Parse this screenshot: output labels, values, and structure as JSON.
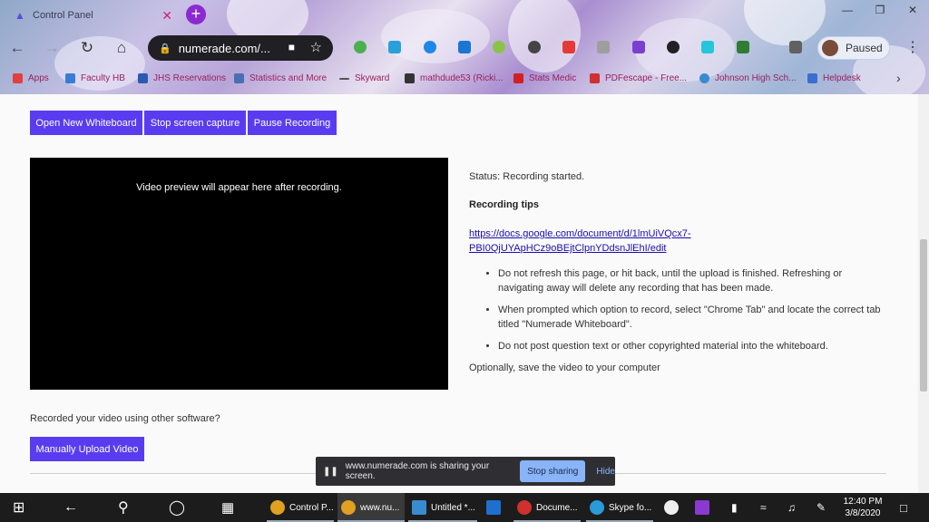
{
  "browser": {
    "tab_title": "Control Panel",
    "url": "numerade.com/...",
    "profile_status": "Paused"
  },
  "bookmarks": [
    {
      "label": "Apps",
      "color": "#e04040"
    },
    {
      "label": "Faculty HB",
      "color": "#3a7bd5"
    },
    {
      "label": "JHS Reservations",
      "color": "#2a5ab0"
    },
    {
      "label": "Statistics and More",
      "color": "#4a6fb0"
    },
    {
      "label": "Skyward",
      "color": "#555555"
    },
    {
      "label": "mathdude53 (Ricki...",
      "color": "#333333"
    },
    {
      "label": "Stats Medic",
      "color": "#d02020"
    },
    {
      "label": "PDFescape - Free...",
      "color": "#d03030"
    },
    {
      "label": "Johnson High Sch...",
      "color": "#3a8ad0"
    },
    {
      "label": "Helpdesk",
      "color": "#3a6fd0"
    }
  ],
  "toolbar": {
    "new_whiteboard": "Open New Whiteboard",
    "stop_capture": "Stop screen capture",
    "pause_recording": "Pause Recording"
  },
  "preview": {
    "message": "Video preview will appear here after recording."
  },
  "info": {
    "status": "Status: Recording started.",
    "tips_heading": "Recording tips",
    "tips_link": "https://docs.google.com/document/d/1lmUiVQcx7-PBI0QjUYApHCz9oBEjtClpnYDdsnJlEhI/edit",
    "tips": [
      "Do not refresh this page, or hit back, until the upload is finished. Refreshing or navigating away will delete any recording that has been made.",
      "When prompted which option to record, select \"Chrome Tab\" and locate the correct tab titled \"Numerade Whiteboard\".",
      "Do not post question text or other copyrighted material into the whiteboard."
    ],
    "optional": "Optionally, save the video to your computer"
  },
  "upload": {
    "prompt": "Recorded your video using other software?",
    "button": "Manually Upload Video"
  },
  "sharebar": {
    "message": "www.numerade.com is sharing your screen.",
    "stop": "Stop sharing",
    "hide": "Hide"
  },
  "taskbar": {
    "apps": [
      {
        "label": "Control P...",
        "color": "#e0a020"
      },
      {
        "label": "www.nu...",
        "color": "#e0a020"
      },
      {
        "label": "Untitled *...",
        "color": "#3a8ad0"
      },
      {
        "label": "",
        "color": "#1e6fd0"
      },
      {
        "label": "Docume...",
        "color": "#d03030"
      },
      {
        "label": "Skype fo...",
        "color": "#2a9ad8"
      },
      {
        "label": "",
        "color": "#eeeeee"
      },
      {
        "label": "",
        "color": "#8a3ad0"
      }
    ],
    "time": "12:40 PM",
    "date": "3/8/2020"
  }
}
